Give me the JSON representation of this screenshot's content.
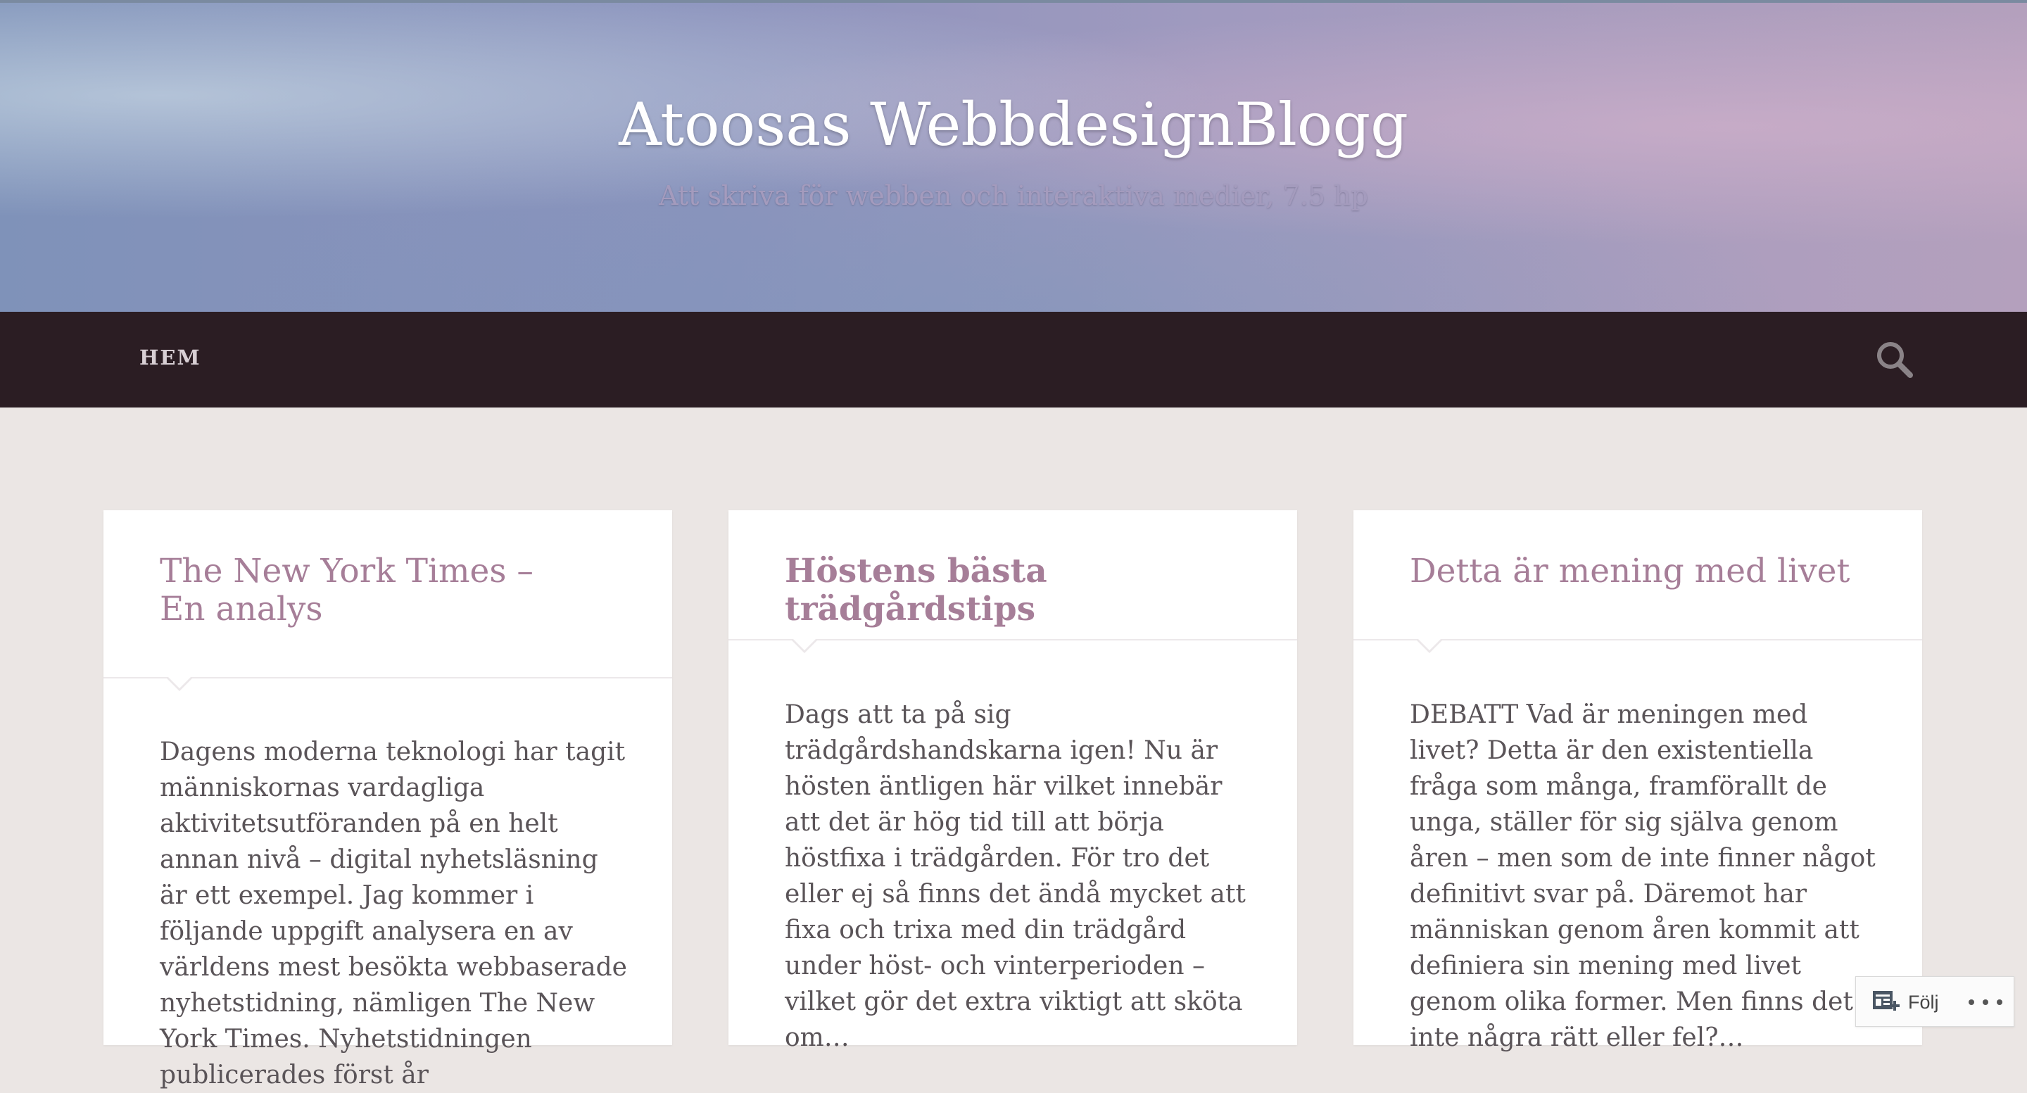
{
  "site": {
    "title": "Atoosas WebbdesignBlogg",
    "description": "Att skriva för webben och interaktiva medier, 7.5 hp"
  },
  "nav": {
    "home_label": "HEM",
    "search_icon": "search-icon"
  },
  "posts": [
    {
      "title_line1": "The New York Times –",
      "title_line2": "En analys",
      "excerpt": "Dagens moderna teknologi har tagit människornas vardagliga aktivitetsutföranden på en helt annan nivå – digital nyhetsläsning är ett exempel. Jag kommer i följande uppgift analysera en av världens mest besökta webbaserade nyhetstidning, nämligen The New York Times. Nyhetstidningen publicerades först år"
    },
    {
      "title": "Höstens bästa trädgårdstips",
      "excerpt": "Dags att ta på sig trädgårdshandskarna igen! Nu är hösten äntligen här vilket innebär att det är hög tid till att börja höstfixa i trädgården. För tro det eller ej så finns det ändå mycket att fixa och trixa med din trädgård under höst- och vinterperioden – vilket gör det extra viktigt att sköta om…"
    },
    {
      "title": "Detta är mening med livet",
      "excerpt": "DEBATT Vad är meningen med livet? Detta är den existentiella fråga som många, framförallt de unga, ställer för sig själva genom åren – men som de inte finner något definitivt svar på. Däremot har människan genom åren kommit att definiera sin mening med livet genom olika former. Men finns det inte några rätt eller fel?…"
    }
  ],
  "follow": {
    "label": "Följ",
    "icon": "reader-follow-icon",
    "more_icon": "more-options-icon"
  },
  "colors": {
    "navbar": "#2b1d23",
    "post_title": "#a67e98",
    "page_bg": "#ebe6e4"
  }
}
